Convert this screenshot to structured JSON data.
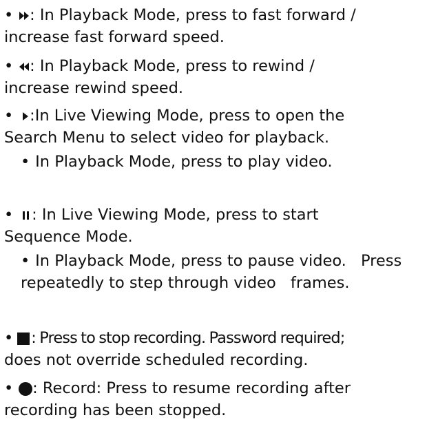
{
  "bullet_char": "•",
  "items": [
    {
      "icon": "fast-forward-icon",
      "lines": [
        ": In Playback Mode, press to fast forward /",
        "increase fast forward speed."
      ]
    },
    {
      "icon": "rewind-icon",
      "lines": [
        ": In Playback Mode, press to rewind /",
        "increase rewind speed."
      ]
    },
    {
      "icon": "play-icon",
      "lines": [
        ":In Live Viewing Mode, press to open the",
        "Search Menu to select video for playback."
      ],
      "sub": {
        "lines": [
          "In Playback Mode, press to play video."
        ]
      }
    },
    {
      "icon": "pause-icon",
      "lines": [
        ": In Live Viewing Mode, press to start",
        "Sequence Mode."
      ],
      "sub": {
        "lines": [
          "In Playback Mode, press to pause video.",
          "Press repeatedly to step through video",
          "frames."
        ]
      }
    },
    {
      "icon": "stop-icon",
      "lines": [
        ": Press to stop recording. Password required;",
        "does not override scheduled recording."
      ]
    },
    {
      "icon": "record-icon",
      "lines": [
        ": Record: Press to resume recording after",
        "recording has been stopped."
      ]
    }
  ]
}
